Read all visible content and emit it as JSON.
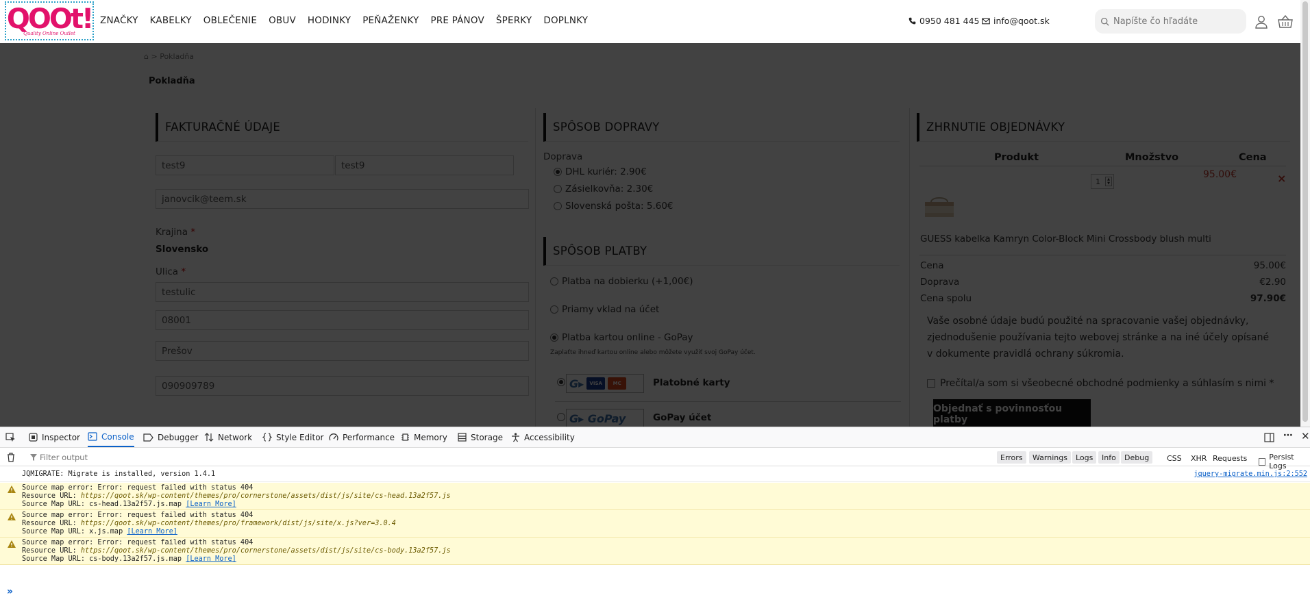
{
  "header": {
    "logo_text": "QOOt!",
    "logo_tagline": "Quality Online Outlet",
    "nav": [
      "ZNAČKY",
      "KABELKY",
      "OBLEČENIE",
      "OBUV",
      "HODINKY",
      "PEŇAŽENKY",
      "PRE PÁNOV",
      "ŠPERKY",
      "DOPLNKY"
    ],
    "phone": "0950 481 445",
    "email": "info@qoot.sk",
    "search_placeholder": "Napíšte čo hľadáte"
  },
  "breadcrumb": {
    "separator": ">",
    "current": "Pokladňa"
  },
  "page_title": "Pokladňa",
  "billing": {
    "heading": "FAKTURAČNÉ ÚDAJE",
    "first_name": "test9",
    "last_name": "test9",
    "email": "janovcik@teem.sk",
    "country_label": "Krajina",
    "country_value": "Slovensko",
    "street_label": "Ulica",
    "required_mark": "*",
    "street": "testulic",
    "zip": "08001",
    "city": "Prešov",
    "phone": "090909789"
  },
  "shipping": {
    "heading": "SPÔSOB DOPRAVY",
    "label": "Doprava",
    "options": [
      {
        "label": "DHL kuriér: 2.90€",
        "selected": true
      },
      {
        "label": "Zásielkovňa: 2.30€",
        "selected": false
      },
      {
        "label": "Slovenská pošta: 5.60€",
        "selected": false
      }
    ]
  },
  "payment": {
    "heading": "SPÔSOB PLATBY",
    "options": [
      {
        "label": "Platba na dobierku (+1,00€)",
        "selected": false
      },
      {
        "label": "Priamy vklad na účet",
        "selected": false
      },
      {
        "label": "Platba kartou online - GoPay",
        "selected": true
      }
    ],
    "gopay_note": "Zaplaťte ihneď kartou online alebo môžete využiť svoj GoPay účet.",
    "methods": [
      {
        "name": "Platobné karty",
        "logo_text": "G▸",
        "selected": true
      },
      {
        "name": "GoPay účet",
        "logo_text": "G▸ GoPay",
        "selected": false
      }
    ],
    "card_brands": [
      "VISA",
      "MC"
    ]
  },
  "summary": {
    "heading": "ZHRNUTIE OBJEDNÁVKY",
    "col_product": "Produkt",
    "col_qty": "Množstvo",
    "col_price": "Cena",
    "item": {
      "qty": "1",
      "price": "95.00€",
      "remove": "×",
      "name": "GUESS kabelka Kamryn Color-Block Mini Crossbody blush multi"
    },
    "rows": [
      {
        "label": "Cena",
        "value": "95.00€",
        "bold": false
      },
      {
        "label": "Doprava",
        "value": "€2.90",
        "bold": false
      },
      {
        "label": "Cena spolu",
        "value": "97.90€",
        "bold": true
      }
    ],
    "privacy_text": "Vaše osobné údaje budú použité na spracovanie vašej objednávky, zjednodušenie používania tejto webovej stránke a na iné účely opísané v dokumente ",
    "privacy_link": "pravidlá ochrany súkromia",
    "privacy_end": ".",
    "terms": "Prečítal/a som si všeobecné obchodné podmienky a súhlasím s nimi *",
    "order_button": "Objednať s povinnosťou platby"
  },
  "devtools": {
    "tabs": [
      "Inspector",
      "Console",
      "Debugger",
      "Network",
      "Style Editor",
      "Performance",
      "Memory",
      "Storage",
      "Accessibility"
    ],
    "active_tab": "Console",
    "filter_placeholder": "Filter output",
    "levels": [
      "Errors",
      "Warnings",
      "Logs",
      "Info",
      "Debug"
    ],
    "categories": [
      "CSS",
      "XHR",
      "Requests"
    ],
    "persist_logs": "Persist Logs",
    "messages": [
      {
        "type": "log",
        "text": "JQMIGRATE: Migrate is installed, version 1.4.1",
        "source": "jquery-migrate.min.js:2:552"
      },
      {
        "type": "warning",
        "line1": "Source map error: Error: request failed with status 404",
        "line2_label": "Resource URL: ",
        "line2_url": "https://qoot.sk/wp-content/themes/pro/cornerstone/assets/dist/js/site/cs-head.13a2f57.js",
        "line3_label": "Source Map URL: cs-head.13a2f57.js.map ",
        "learn_more": "[Learn More]"
      },
      {
        "type": "warning",
        "line1": "Source map error: Error: request failed with status 404",
        "line2_label": "Resource URL: ",
        "line2_url": "https://qoot.sk/wp-content/themes/pro/framework/dist/js/site/x.js?ver=3.0.4",
        "line3_label": "Source Map URL: x.js.map ",
        "learn_more": "[Learn More]"
      },
      {
        "type": "warning",
        "line1": "Source map error: Error: request failed with status 404",
        "line2_label": "Resource URL: ",
        "line2_url": "https://qoot.sk/wp-content/themes/pro/cornerstone/assets/dist/js/site/cs-body.13a2f57.js",
        "line3_label": "Source Map URL: cs-body.13a2f57.js.map ",
        "learn_more": "[Learn More]"
      }
    ],
    "prompt": "»"
  },
  "colors": {
    "brand": "#e2126b",
    "accent_link": "#0a60c8",
    "overlay": "#000000",
    "price_red": "#c0392b",
    "warning_bg": "#fffbd6"
  }
}
